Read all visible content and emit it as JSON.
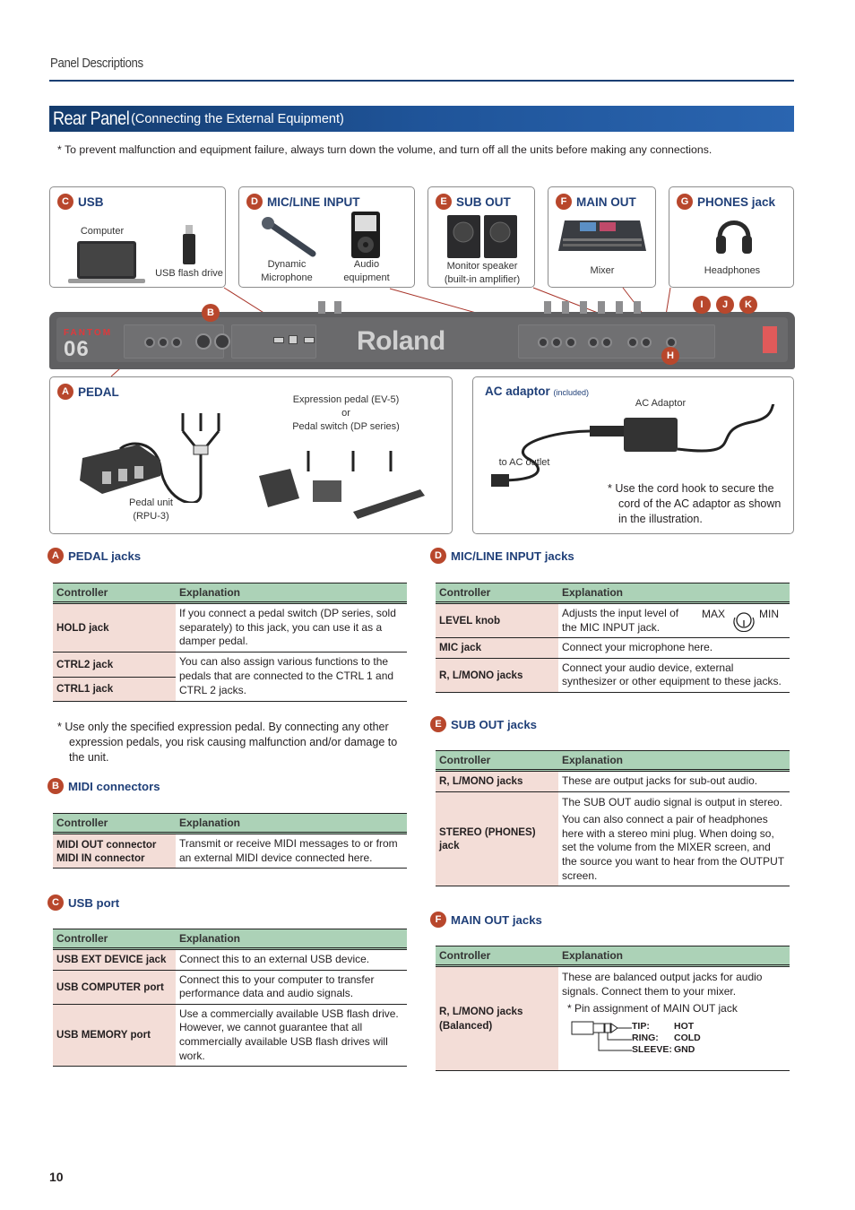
{
  "header": {
    "section": "Panel Descriptions",
    "page_number": "10"
  },
  "title": {
    "main": "Rear Panel",
    "sub": "(Connecting the External Equipment)"
  },
  "top_note": "* To prevent malfunction and equipment failure, always turn down the volume, and turn off all the units before making any connections.",
  "colors": {
    "brand_blue": "#1f3f78",
    "badge": "#b8472c",
    "table_header": "#acd2b7",
    "controller_cell": "#f3ddd7"
  },
  "boxes": {
    "usb": {
      "badge": "C",
      "title": "USB",
      "items": [
        "Computer",
        "USB flash drive"
      ]
    },
    "mic": {
      "badge": "D",
      "title": "MIC/LINE INPUT",
      "items": [
        "Dynamic\nMicrophone",
        "Audio\nequipment"
      ]
    },
    "sub": {
      "badge": "E",
      "title": "SUB OUT",
      "items": [
        "Monitor speaker\n(built-in amplifier)"
      ]
    },
    "main": {
      "badge": "F",
      "title": "MAIN OUT",
      "items": [
        "Mixer"
      ]
    },
    "phones": {
      "badge": "G",
      "title": "PHONES jack",
      "items": [
        "Headphones"
      ]
    },
    "pedal": {
      "badge": "A",
      "title": "PEDAL",
      "unit_label": "Pedal unit\n(RPU-3)",
      "expr_label": "Expression pedal (EV-5)\nor\nPedal switch (DP series)"
    },
    "ac": {
      "title": "AC adaptor",
      "title_note": "(included)",
      "adaptor_label": "AC Adaptor",
      "outlet_label": "to AC outlet",
      "note": "* Use the cord hook to secure the cord of the AC adaptor as shown in the illustration."
    }
  },
  "panel": {
    "model_top": "FANTOM",
    "model_num": "06",
    "brand": "Roland",
    "callouts": [
      "B",
      "H",
      "I",
      "J",
      "K"
    ]
  },
  "tables": {
    "pedal": {
      "badge": "A",
      "heading": "PEDAL jacks",
      "columns": [
        "Controller",
        "Explanation"
      ],
      "rows": [
        {
          "controller": "HOLD jack",
          "explanation": "If you connect a pedal switch (DP series, sold separately) to this jack, you can use it as a damper pedal."
        },
        {
          "controller": "CTRL2 jack",
          "explanation": "You can also assign various functions to the pedals that are connected to the CTRL 1 and CTRL 2 jacks."
        },
        {
          "controller": "CTRL1 jack"
        }
      ],
      "note": "* Use only the specified expression pedal. By connecting any other expression pedals, you risk causing malfunction and/or damage to the unit."
    },
    "midi": {
      "badge": "B",
      "heading": "MIDI connectors",
      "columns": [
        "Controller",
        "Explanation"
      ],
      "rows": [
        {
          "controller": "MIDI OUT connector\nMIDI IN connector",
          "explanation": "Transmit or receive MIDI messages to or from an external MIDI device connected here."
        }
      ]
    },
    "usb": {
      "badge": "C",
      "heading": "USB port",
      "columns": [
        "Controller",
        "Explanation"
      ],
      "rows": [
        {
          "controller": "USB EXT DEVICE jack",
          "explanation": "Connect this to an external USB device."
        },
        {
          "controller": "USB COMPUTER port",
          "explanation": "Connect this to your computer to transfer performance data and audio signals."
        },
        {
          "controller": "USB MEMORY port",
          "explanation": "Use a commercially available USB flash drive. However, we cannot guarantee that all commercially available USB flash drives will work."
        }
      ]
    },
    "mic": {
      "badge": "D",
      "heading": "MIC/LINE INPUT jacks",
      "columns": [
        "Controller",
        "Explanation"
      ],
      "rows": [
        {
          "controller": "LEVEL knob",
          "explanation": "Adjusts the input level of the MIC INPUT jack.",
          "knob_max": "MAX",
          "knob_min": "MIN"
        },
        {
          "controller": "MIC jack",
          "explanation": "Connect your microphone here."
        },
        {
          "controller": "R, L/MONO jacks",
          "explanation": "Connect your audio device, external synthesizer or other equipment to these jacks."
        }
      ]
    },
    "sub": {
      "badge": "E",
      "heading": "SUB OUT jacks",
      "columns": [
        "Controller",
        "Explanation"
      ],
      "rows": [
        {
          "controller": "R, L/MONO jacks",
          "explanation": "These are output jacks for sub-out audio."
        },
        {
          "controller": "STEREO (PHONES) jack",
          "explanation": "The SUB OUT audio signal is output in stereo.",
          "explanation2": "You can also connect a pair of headphones here with a stereo mini plug. When doing so, set the volume from the MIXER screen, and the source you want to hear from the OUTPUT screen."
        }
      ]
    },
    "main": {
      "badge": "F",
      "heading": "MAIN OUT jacks",
      "columns": [
        "Controller",
        "Explanation"
      ],
      "rows": [
        {
          "controller": "R, L/MONO jacks\n(Balanced)",
          "explanation": "These are balanced output jacks for audio signals. Connect them to your mixer.",
          "pin_note": "* Pin assignment of MAIN OUT jack",
          "pins": [
            {
              "name": "TIP:",
              "value": "HOT"
            },
            {
              "name": "RING:",
              "value": "COLD"
            },
            {
              "name": "SLEEVE:",
              "value": "GND"
            }
          ]
        }
      ]
    }
  }
}
